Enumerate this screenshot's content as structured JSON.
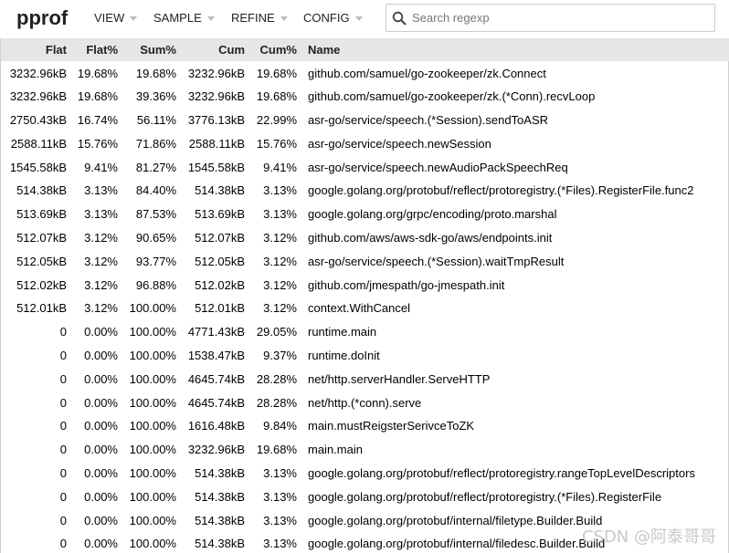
{
  "header": {
    "logo": "pprof",
    "menus": [
      {
        "label": "VIEW"
      },
      {
        "label": "SAMPLE"
      },
      {
        "label": "REFINE"
      },
      {
        "label": "CONFIG"
      }
    ],
    "search": {
      "placeholder": "Search regexp",
      "value": "",
      "icon": "search-icon"
    }
  },
  "table": {
    "columns": [
      "Flat",
      "Flat%",
      "Sum%",
      "Cum",
      "Cum%",
      "Name"
    ],
    "rows": [
      [
        "3232.96kB",
        "19.68%",
        "19.68%",
        "3232.96kB",
        "19.68%",
        "github.com/samuel/go-zookeeper/zk.Connect"
      ],
      [
        "3232.96kB",
        "19.68%",
        "39.36%",
        "3232.96kB",
        "19.68%",
        "github.com/samuel/go-zookeeper/zk.(*Conn).recvLoop"
      ],
      [
        "2750.43kB",
        "16.74%",
        "56.11%",
        "3776.13kB",
        "22.99%",
        "asr-go/service/speech.(*Session).sendToASR"
      ],
      [
        "2588.11kB",
        "15.76%",
        "71.86%",
        "2588.11kB",
        "15.76%",
        "asr-go/service/speech.newSession"
      ],
      [
        "1545.58kB",
        "9.41%",
        "81.27%",
        "1545.58kB",
        "9.41%",
        "asr-go/service/speech.newAudioPackSpeechReq"
      ],
      [
        "514.38kB",
        "3.13%",
        "84.40%",
        "514.38kB",
        "3.13%",
        "google.golang.org/protobuf/reflect/protoregistry.(*Files).RegisterFile.func2"
      ],
      [
        "513.69kB",
        "3.13%",
        "87.53%",
        "513.69kB",
        "3.13%",
        "google.golang.org/grpc/encoding/proto.marshal"
      ],
      [
        "512.07kB",
        "3.12%",
        "90.65%",
        "512.07kB",
        "3.12%",
        "github.com/aws/aws-sdk-go/aws/endpoints.init"
      ],
      [
        "512.05kB",
        "3.12%",
        "93.77%",
        "512.05kB",
        "3.12%",
        "asr-go/service/speech.(*Session).waitTmpResult"
      ],
      [
        "512.02kB",
        "3.12%",
        "96.88%",
        "512.02kB",
        "3.12%",
        "github.com/jmespath/go-jmespath.init"
      ],
      [
        "512.01kB",
        "3.12%",
        "100.00%",
        "512.01kB",
        "3.12%",
        "context.WithCancel"
      ],
      [
        "0",
        "0.00%",
        "100.00%",
        "4771.43kB",
        "29.05%",
        "runtime.main"
      ],
      [
        "0",
        "0.00%",
        "100.00%",
        "1538.47kB",
        "9.37%",
        "runtime.doInit"
      ],
      [
        "0",
        "0.00%",
        "100.00%",
        "4645.74kB",
        "28.28%",
        "net/http.serverHandler.ServeHTTP"
      ],
      [
        "0",
        "0.00%",
        "100.00%",
        "4645.74kB",
        "28.28%",
        "net/http.(*conn).serve"
      ],
      [
        "0",
        "0.00%",
        "100.00%",
        "1616.48kB",
        "9.84%",
        "main.mustReigsterSerivceToZK"
      ],
      [
        "0",
        "0.00%",
        "100.00%",
        "3232.96kB",
        "19.68%",
        "main.main"
      ],
      [
        "0",
        "0.00%",
        "100.00%",
        "514.38kB",
        "3.13%",
        "google.golang.org/protobuf/reflect/protoregistry.rangeTopLevelDescriptors"
      ],
      [
        "0",
        "0.00%",
        "100.00%",
        "514.38kB",
        "3.13%",
        "google.golang.org/protobuf/reflect/protoregistry.(*Files).RegisterFile"
      ],
      [
        "0",
        "0.00%",
        "100.00%",
        "514.38kB",
        "3.13%",
        "google.golang.org/protobuf/internal/filetype.Builder.Build"
      ],
      [
        "0",
        "0.00%",
        "100.00%",
        "514.38kB",
        "3.13%",
        "google.golang.org/protobuf/internal/filedesc.Builder.Build"
      ]
    ]
  },
  "watermark": "CSDN @阿泰哥哥",
  "colors": {
    "header_row_bg": "#e6e6e6",
    "caret": "#bbbbbb",
    "search_border": "#cccccc"
  }
}
